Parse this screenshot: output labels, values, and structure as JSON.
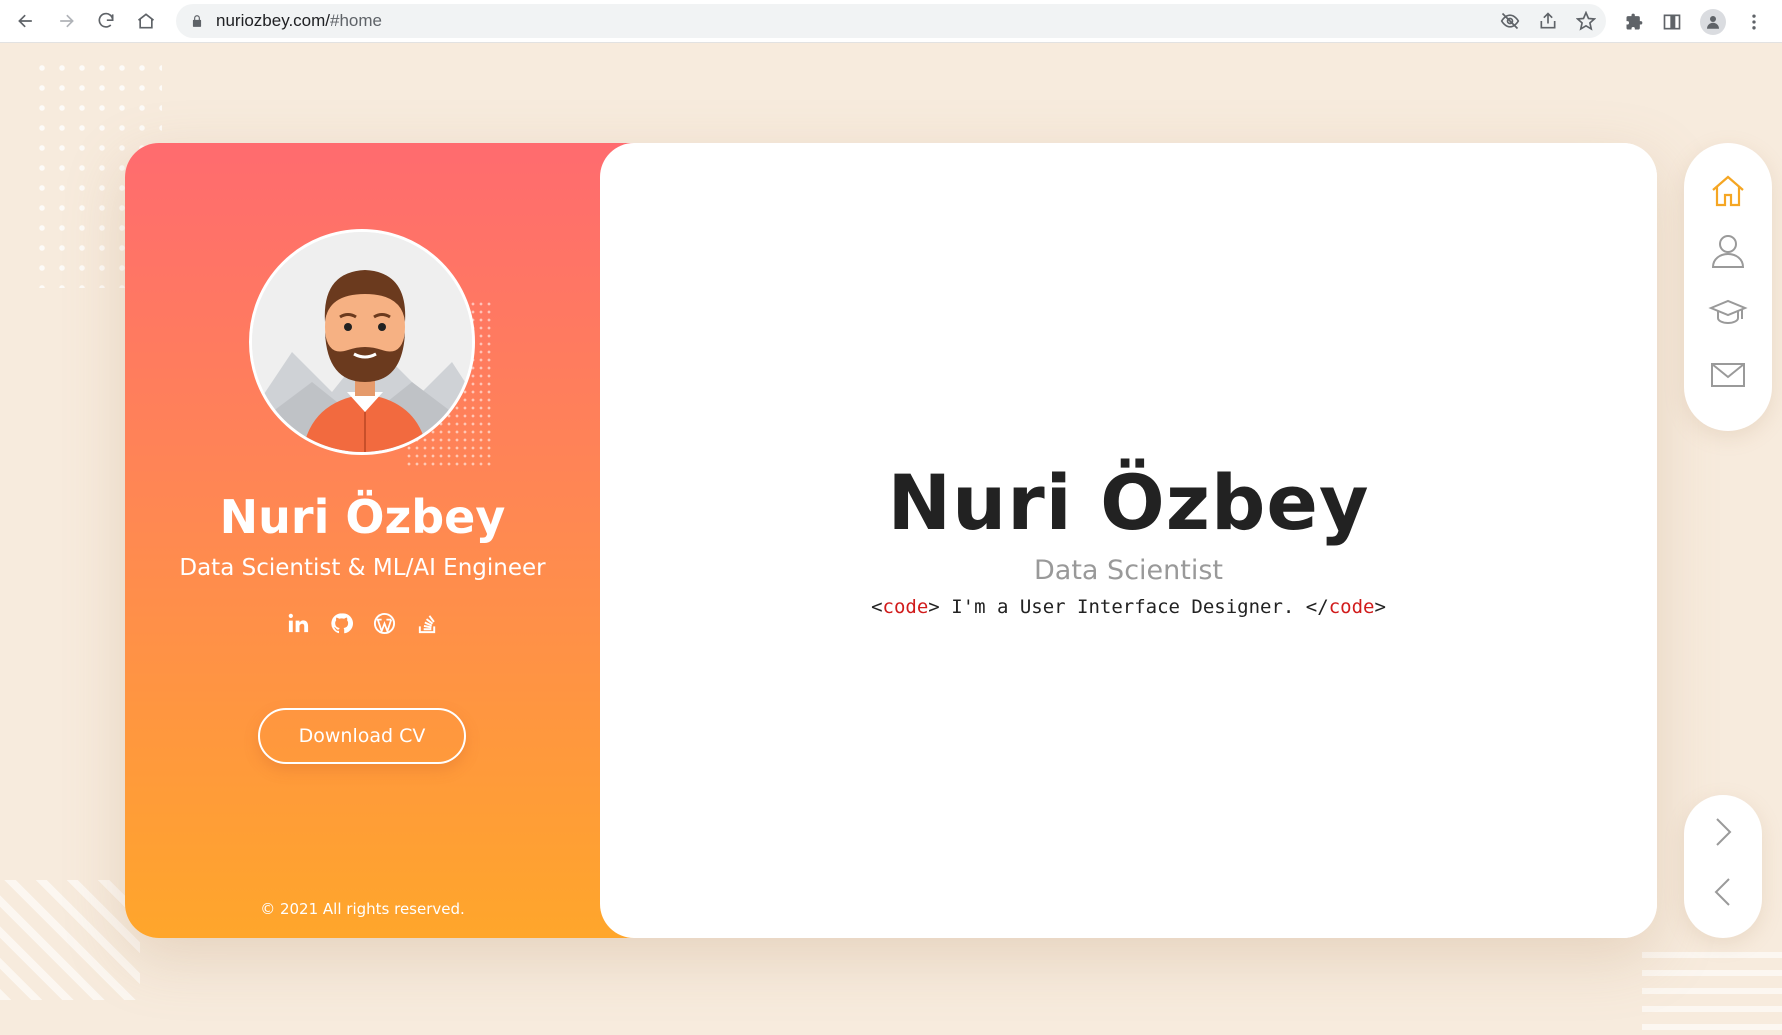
{
  "browser": {
    "url_host": "nuriozbey.com/",
    "url_path": "#home",
    "icons": [
      "back-icon",
      "forward-icon",
      "reload-icon",
      "home-icon",
      "lock-icon",
      "eye-off-icon",
      "share-icon",
      "star-icon",
      "extensions-icon",
      "side-panel-icon",
      "profile-icon",
      "menu-icon"
    ]
  },
  "profile": {
    "name": "Nuri Özbey",
    "role": "Data Scientist & ML/AI Engineer",
    "social": [
      "linkedin-icon",
      "github-icon",
      "wordpress-icon",
      "stackoverflow-icon"
    ],
    "cv_button": "Download CV",
    "copyright": "© 2021 All rights reserved."
  },
  "hero": {
    "name": "Nuri Özbey",
    "role": "Data Scientist",
    "code_open_lt": "<",
    "code_tag": "code",
    "code_open_gt": ">",
    "code_text": " I'm a User Interface Designer. ",
    "code_close_lt": "</",
    "code_close_gt": ">"
  },
  "side_nav": {
    "items": [
      "home-icon",
      "user-icon",
      "graduation-cap-icon",
      "mail-icon"
    ],
    "active_color": "#f5a623",
    "inactive_color": "#9a9a9a"
  },
  "colors": {
    "gradient_top": "#ff6b6f",
    "gradient_bottom": "#ffa62b",
    "page_bg": "#f7ebdd"
  }
}
